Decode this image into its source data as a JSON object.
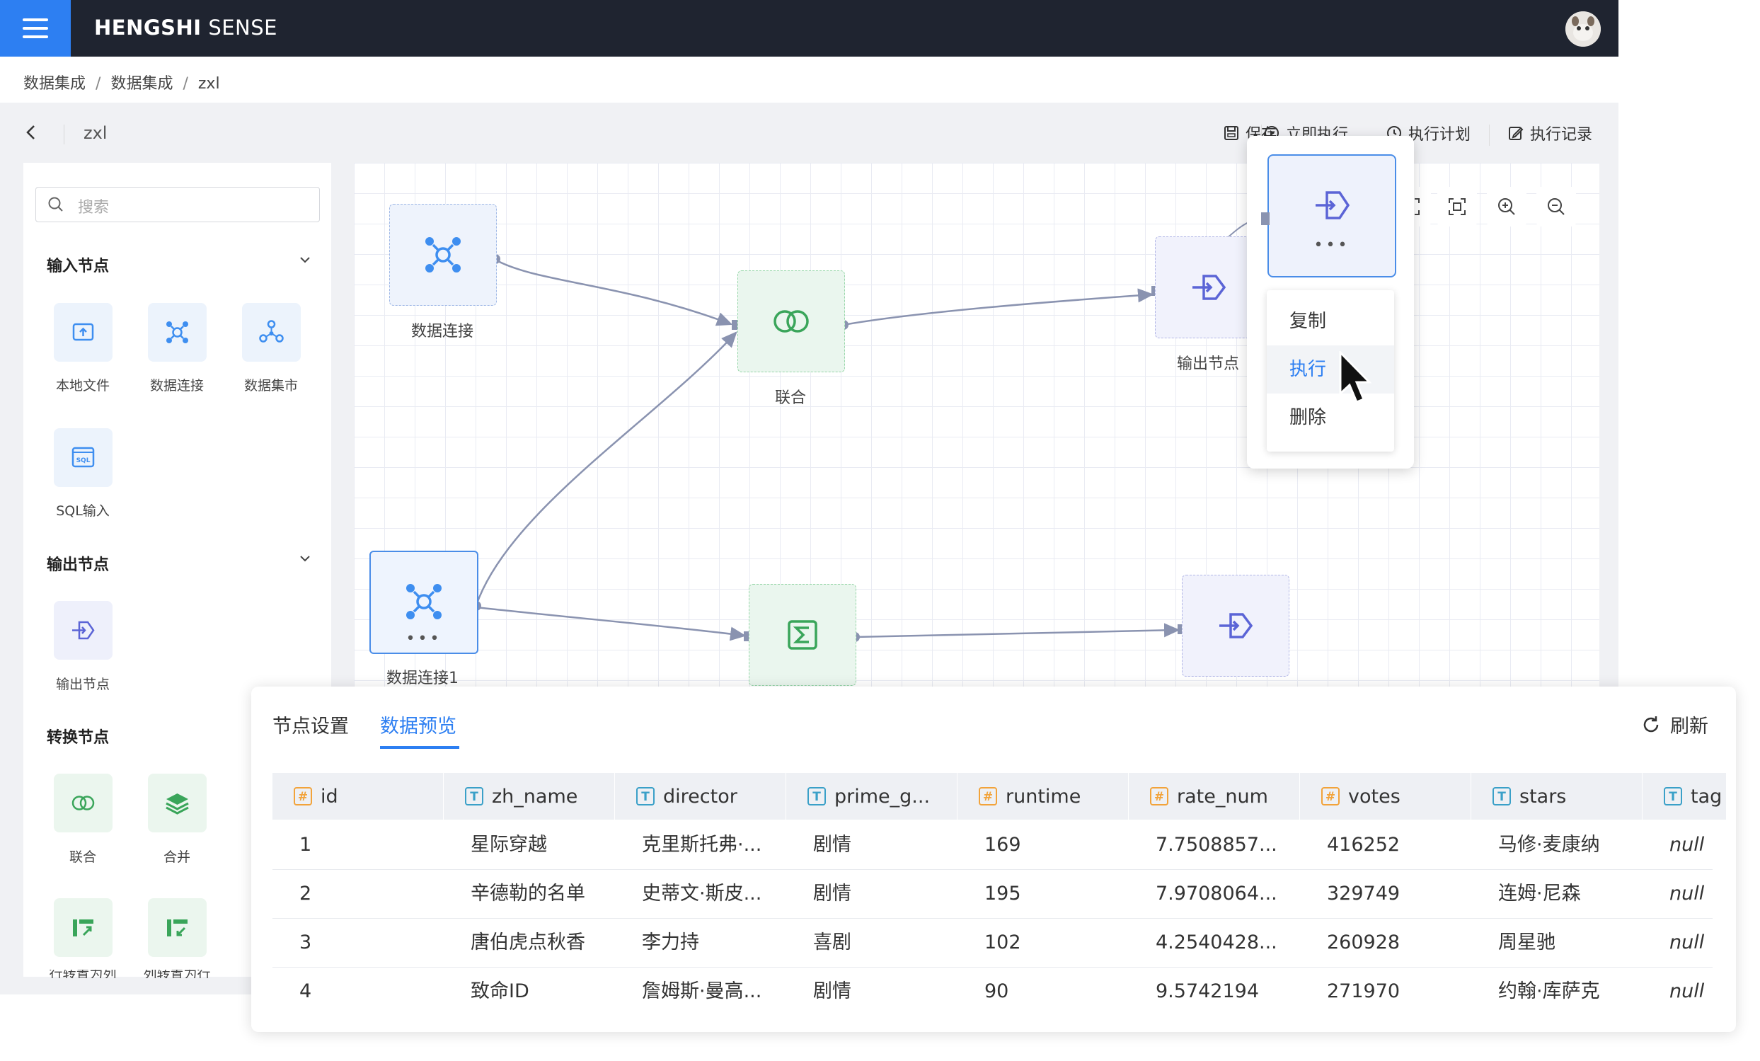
{
  "app": {
    "brand_bold": "HENGSHI",
    "brand_rest": " SENSE"
  },
  "breadcrumb": [
    "数据集成",
    "数据集成",
    "zxl"
  ],
  "flow": {
    "name": "zxl"
  },
  "toolbar": {
    "save": "保存",
    "run_now": "立即执行",
    "schedule": "执行计划",
    "records": "执行记录"
  },
  "sidebar": {
    "search_placeholder": "搜索",
    "input_section": "输入节点",
    "input_items": [
      "本地文件",
      "数据连接",
      "数据集市",
      "SQL输入"
    ],
    "output_section": "输出节点",
    "output_items": [
      "输出节点"
    ],
    "transform_section": "转换节点",
    "transform_items": [
      "联合",
      "合并",
      "行转置为列",
      "列转置为行"
    ]
  },
  "canvas": {
    "nodes": {
      "conn1": "数据连接",
      "join": "联合",
      "out1": "输出节点",
      "conn2": "数据连接1"
    }
  },
  "context_menu": {
    "items": [
      "复制",
      "执行",
      "删除"
    ],
    "active": "执行"
  },
  "bottom_panel": {
    "tabs": [
      "节点设置",
      "数据预览"
    ],
    "active_tab": "数据预览",
    "refresh": "刷新",
    "columns": [
      {
        "type": "#",
        "name": "id"
      },
      {
        "type": "T",
        "name": "zh_name"
      },
      {
        "type": "T",
        "name": "director"
      },
      {
        "type": "T",
        "name": "prime_g..."
      },
      {
        "type": "#",
        "name": "runtime"
      },
      {
        "type": "#",
        "name": "rate_num"
      },
      {
        "type": "#",
        "name": "votes"
      },
      {
        "type": "T",
        "name": "stars"
      },
      {
        "type": "T",
        "name": "tag"
      }
    ],
    "rows": [
      [
        "1",
        "星际穿越",
        "克里斯托弗·...",
        "剧情",
        "169",
        "7.7508857...",
        "416252",
        "马修·麦康纳",
        "null"
      ],
      [
        "2",
        "辛德勒的名单",
        "史蒂文·斯皮...",
        "剧情",
        "195",
        "7.9708064...",
        "329749",
        "连姆·尼森",
        "null"
      ],
      [
        "3",
        "唐伯虎点秋香",
        "李力持",
        "喜剧",
        "102",
        "4.2540428...",
        "260928",
        "周星驰",
        "null"
      ],
      [
        "4",
        "致命ID",
        "詹姆斯·曼高...",
        "剧情",
        "90",
        "9.5742194",
        "271970",
        "约翰·库萨克",
        "null"
      ]
    ]
  },
  "colors": {
    "accent": "#2d7ff2",
    "topbar": "#1f2430"
  }
}
